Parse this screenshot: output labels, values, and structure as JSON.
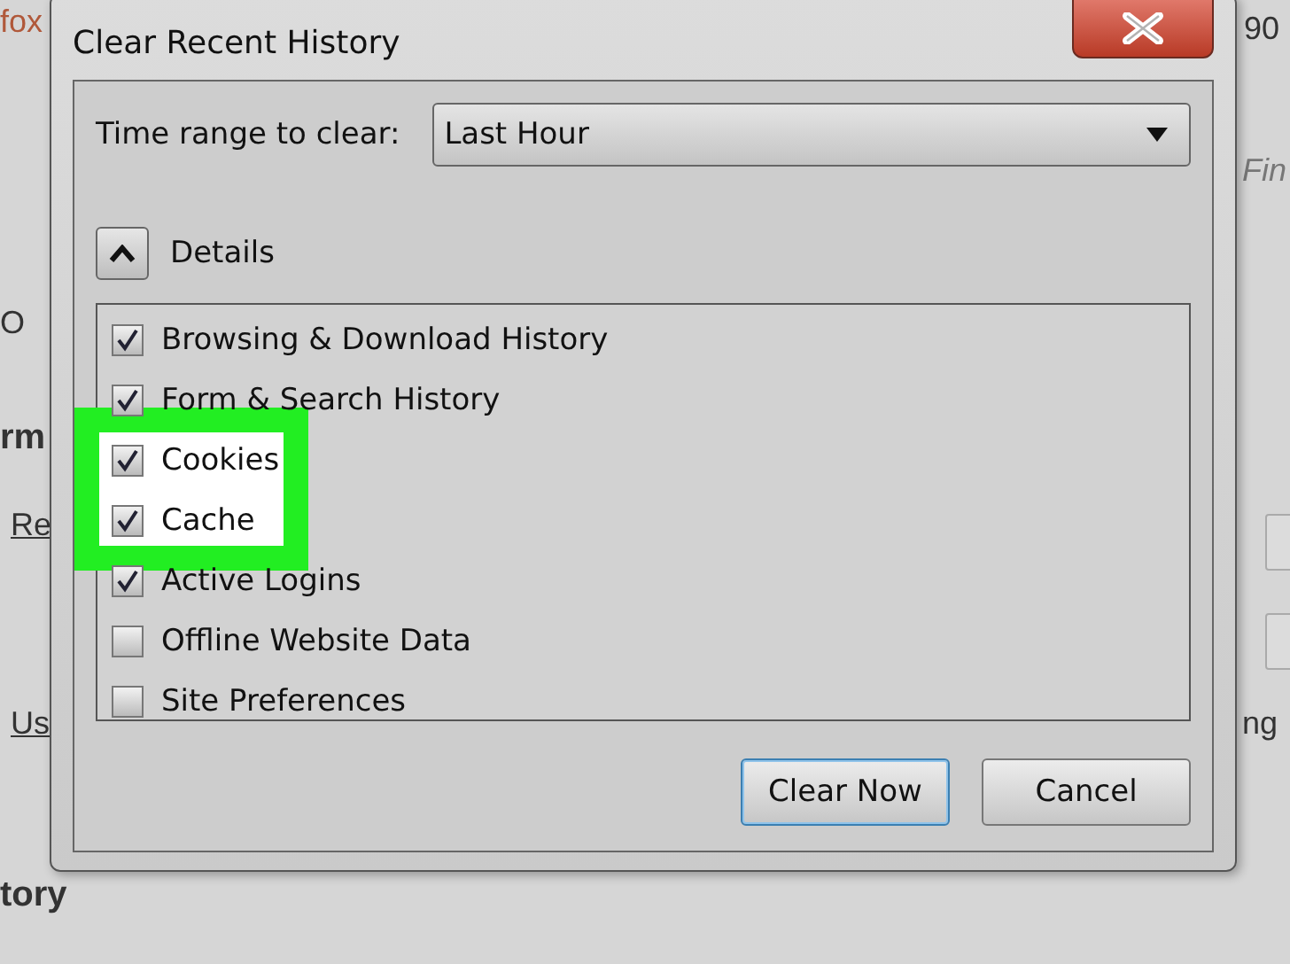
{
  "background_page": {
    "fragments": [
      {
        "kind": "title",
        "text": "fox"
      },
      {
        "kind": "text",
        "text": "O"
      },
      {
        "kind": "heading",
        "text": "rm"
      },
      {
        "kind": "link",
        "text": "Re"
      },
      {
        "kind": "link",
        "text": "Us"
      },
      {
        "kind": "heading",
        "text": "tory"
      },
      {
        "kind": "text",
        "text": "90"
      },
      {
        "kind": "placeholder",
        "text": "Fin"
      },
      {
        "kind": "text",
        "text": "ng"
      }
    ]
  },
  "dialog": {
    "title": "Clear Recent History",
    "time_range": {
      "label": "Time range to clear:",
      "value": "Last Hour"
    },
    "details": {
      "label": "Details",
      "expanded": true
    },
    "items": [
      {
        "label": "Browsing & Download History",
        "checked": true,
        "highlighted": false
      },
      {
        "label": "Form & Search History",
        "checked": true,
        "highlighted": false
      },
      {
        "label": "Cookies",
        "checked": true,
        "highlighted": true
      },
      {
        "label": "Cache",
        "checked": true,
        "highlighted": true
      },
      {
        "label": "Active Logins",
        "checked": true,
        "highlighted": false
      },
      {
        "label": "Offline Website Data",
        "checked": false,
        "highlighted": false
      },
      {
        "label": "Site Preferences",
        "checked": false,
        "highlighted": false
      }
    ],
    "buttons": [
      {
        "label": "Clear Now",
        "default": true
      },
      {
        "label": "Cancel",
        "default": false
      }
    ]
  }
}
